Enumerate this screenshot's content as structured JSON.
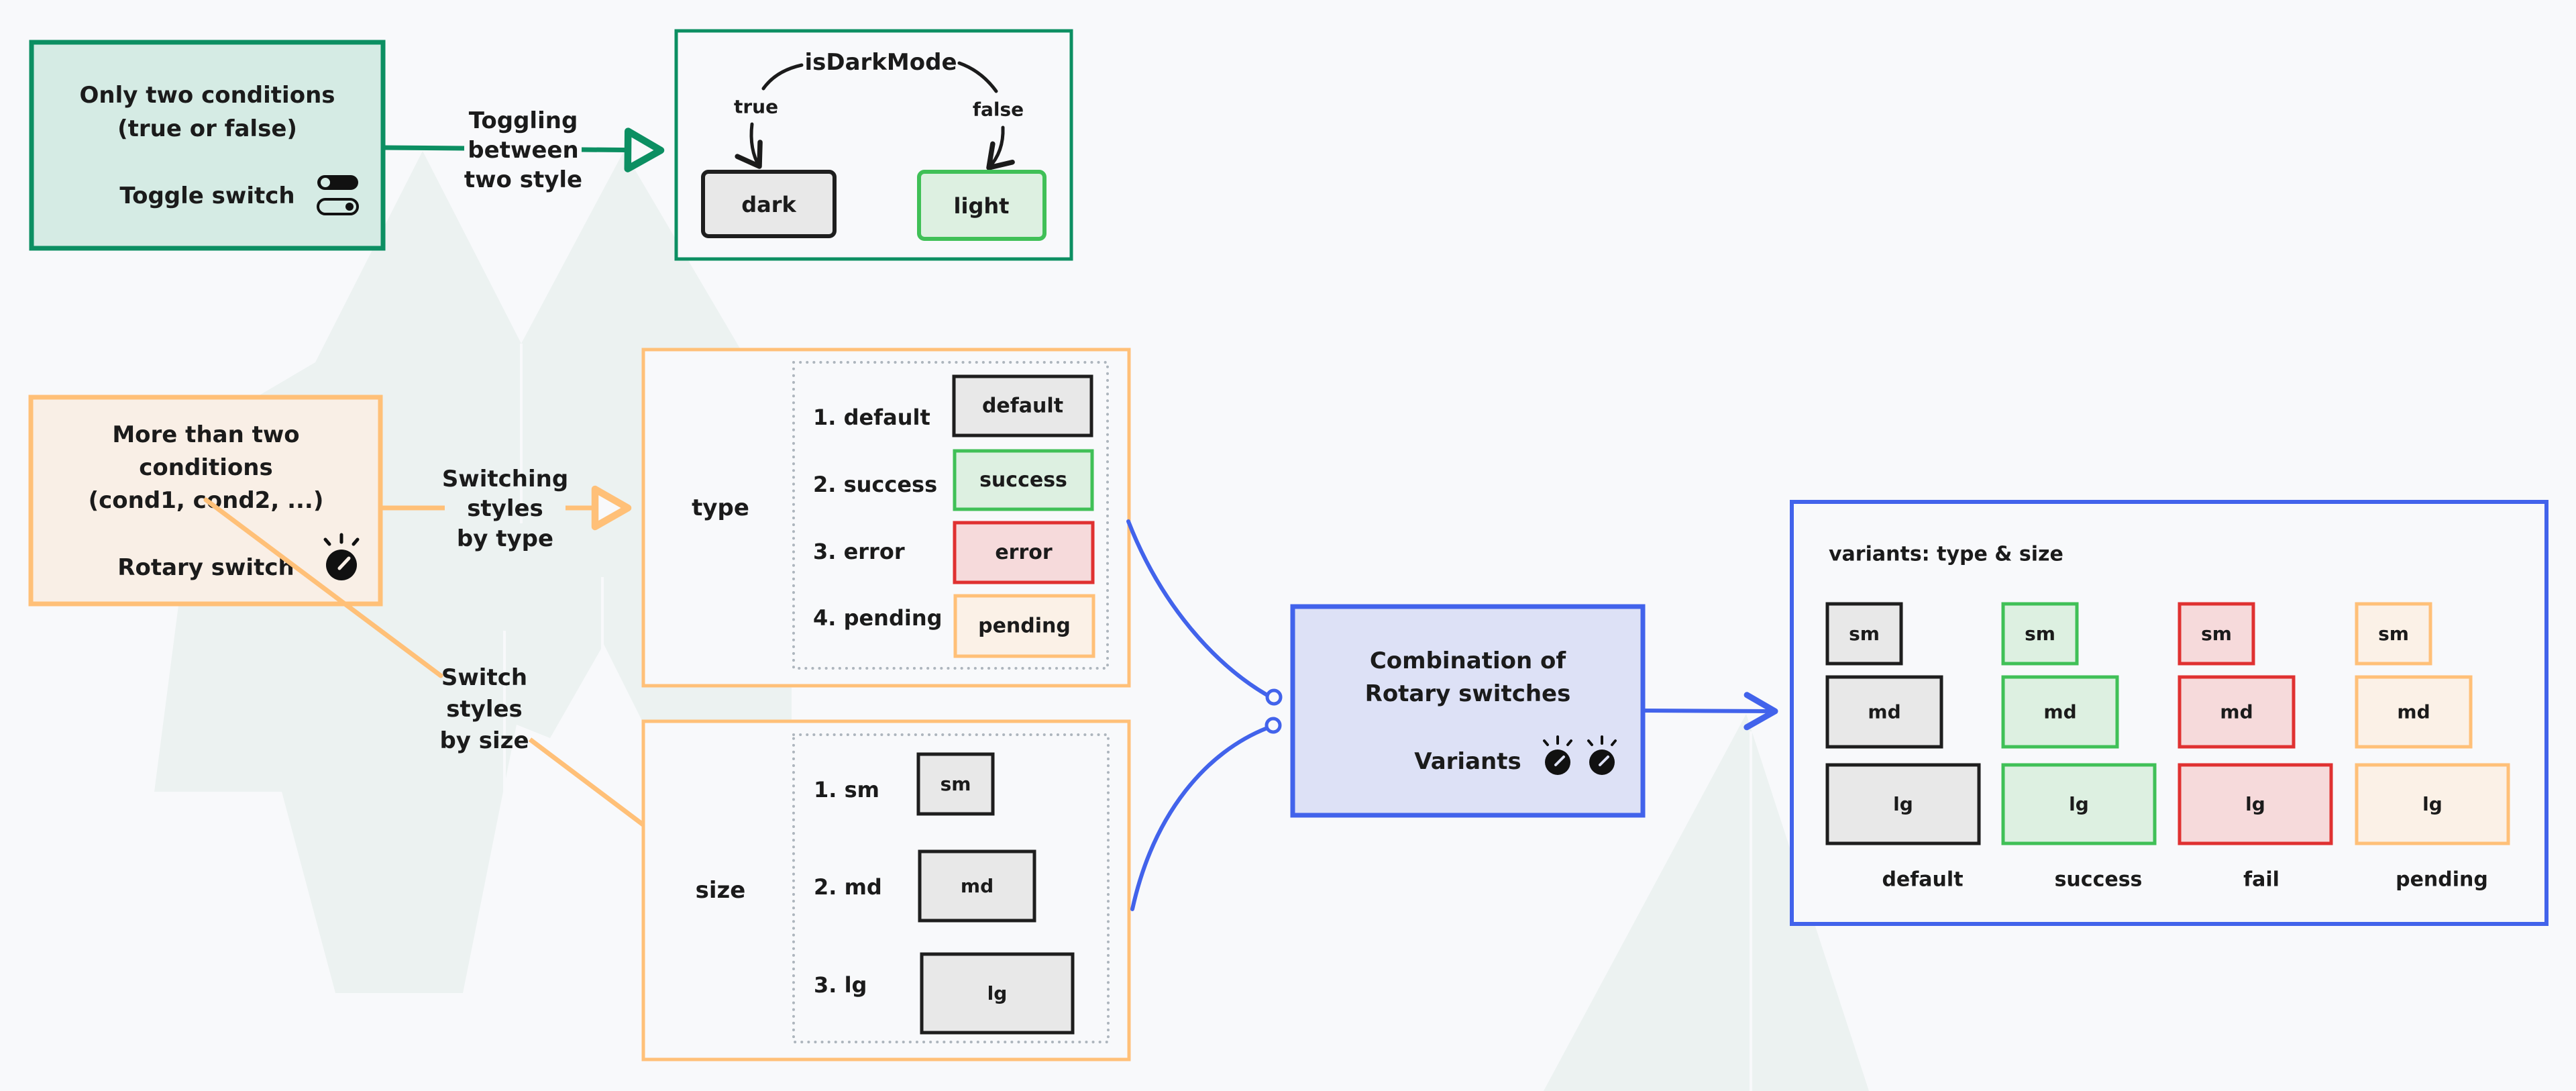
{
  "colors": {
    "background": "#f8f9fb",
    "toggle_border": "#0c8f62",
    "toggle_fill": "#d5ebe4",
    "rotary_border": "#ffc078",
    "rotary_fill": "#f9efe6",
    "combo_border": "#4263eb",
    "combo_fill": "#dde1f6",
    "default_border": "#1e1e1e",
    "default_fill": "#e8e8e8",
    "success_border": "#40c057",
    "success_fill": "#ddf0e1",
    "error_border": "#e03131",
    "error_fill": "#f6dadb",
    "pending_border": "#ffc078",
    "pending_fill": "#fbf1e7",
    "dotted": "#adb5bd",
    "ink": "#1b1b1b"
  },
  "toggle_box": {
    "line1": "Only two conditions",
    "line2": "(true or false)",
    "caption": "Toggle switch",
    "icon": "toggle-switch-icon"
  },
  "toggle_arrow_label": [
    "Toggling",
    "between",
    "two style"
  ],
  "dark_mode_panel": {
    "variable": "isDarkMode",
    "true_label": "true",
    "false_label": "false",
    "dark_label": "dark",
    "light_label": "light"
  },
  "rotary_box": {
    "line1": "More than two",
    "line2": "conditions",
    "line3": "(cond1, cond2, ...)",
    "caption": "Rotary switch",
    "icon": "rotary-knob-icon"
  },
  "type_arrow_label": [
    "Switching",
    "styles",
    "by type"
  ],
  "size_arrow_label": [
    "Switch",
    "styles",
    "by size"
  ],
  "type_panel": {
    "title": "type",
    "items": [
      {
        "label": "1. default",
        "chip": "default",
        "kind": "default"
      },
      {
        "label": "2. success",
        "chip": "success",
        "kind": "success"
      },
      {
        "label": "3. error",
        "chip": "error",
        "kind": "error"
      },
      {
        "label": "4. pending",
        "chip": "pending",
        "kind": "pending"
      }
    ]
  },
  "size_panel": {
    "title": "size",
    "items": [
      {
        "label": "1. sm",
        "chip": "sm"
      },
      {
        "label": "2. md",
        "chip": "md"
      },
      {
        "label": "3. lg",
        "chip": "lg"
      }
    ]
  },
  "combo_box": {
    "line1": "Combination of",
    "line2": "Rotary switches",
    "caption": "Variants",
    "icon": "rotary-knob-icon"
  },
  "variants_panel": {
    "title": "variants: type & size",
    "sizes": [
      "sm",
      "md",
      "lg"
    ],
    "columns": [
      {
        "label": "default",
        "kind": "default"
      },
      {
        "label": "success",
        "kind": "success"
      },
      {
        "label": "fail",
        "kind": "error"
      },
      {
        "label": "pending",
        "kind": "pending"
      }
    ]
  }
}
